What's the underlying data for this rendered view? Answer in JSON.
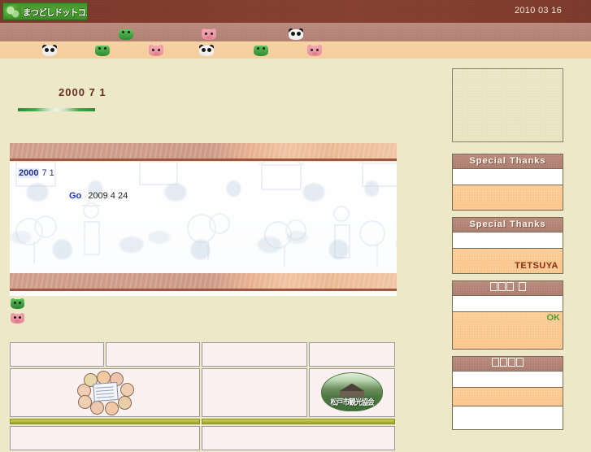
{
  "header": {
    "logo_text": "まつどしドットコム",
    "logo_icon": "leaf-sprout-icon",
    "date": "2010 03 16",
    "background_color": "#7c3a2c",
    "logo_background_color": "#4fa832"
  },
  "decoration_band": {
    "brown_color": "#b08073",
    "tan_color": "#f4cd9a",
    "top_row_critters": [
      "frog",
      "pig",
      "panda"
    ],
    "bottom_row_critters": [
      "panda",
      "frog",
      "pig",
      "panda",
      "frog",
      "pig"
    ]
  },
  "main": {
    "page_heading": "2000  7  1",
    "heading_rule_color": "#2f8a33",
    "news_panel": {
      "date_year": "2000",
      "date_monthday": "7 1",
      "entry_link_label": "Go",
      "entry_date": "2009 4 24",
      "watermark": "boy-with-cap-and-trees-watermark"
    },
    "mini_icons": [
      "frog-icon",
      "pig-icon"
    ],
    "wood_bar_color": "#cd9a87"
  },
  "link_table": {
    "rows": [
      {
        "type": "cells",
        "cells": [
          {
            "content": "",
            "kind": "empty"
          },
          {
            "content": "",
            "kind": "empty"
          },
          {
            "content": "",
            "kind": "empty"
          },
          {
            "content": "",
            "kind": "empty"
          }
        ]
      },
      {
        "type": "cells",
        "cells": [
          {
            "content": "",
            "kind": "empty"
          },
          {
            "content": "",
            "kind": "people-banner-image"
          },
          {
            "content": "",
            "kind": "empty"
          },
          {
            "content": "松戸市観光協会",
            "kind": "tourism-logo-image"
          }
        ]
      },
      {
        "type": "rule"
      },
      {
        "type": "cells",
        "cells": [
          {
            "content": "",
            "kind": "empty"
          },
          {
            "content": "",
            "kind": "empty"
          }
        ]
      }
    ]
  },
  "sidebar": {
    "ad_box": {
      "label": "",
      "name": "ad-placeholder"
    },
    "panels": [
      {
        "title": "Special Thanks",
        "name": "special-thanks-1",
        "credit": ""
      },
      {
        "title": "Special Thanks",
        "name": "special-thanks-2",
        "credit": "TETSUYA"
      },
      {
        "title": "□□□ □",
        "title_tofu_groups": [
          3,
          1
        ],
        "name": "counter-panel",
        "status": "OK"
      },
      {
        "title": "□□□□",
        "title_tofu_groups": [
          4
        ],
        "name": "links-panel",
        "credit": ""
      }
    ],
    "header_color": "#ad7e70",
    "body_color": "#f9c68c",
    "credit_color": "#8f2d14",
    "status_color": "#4f9b2e"
  }
}
